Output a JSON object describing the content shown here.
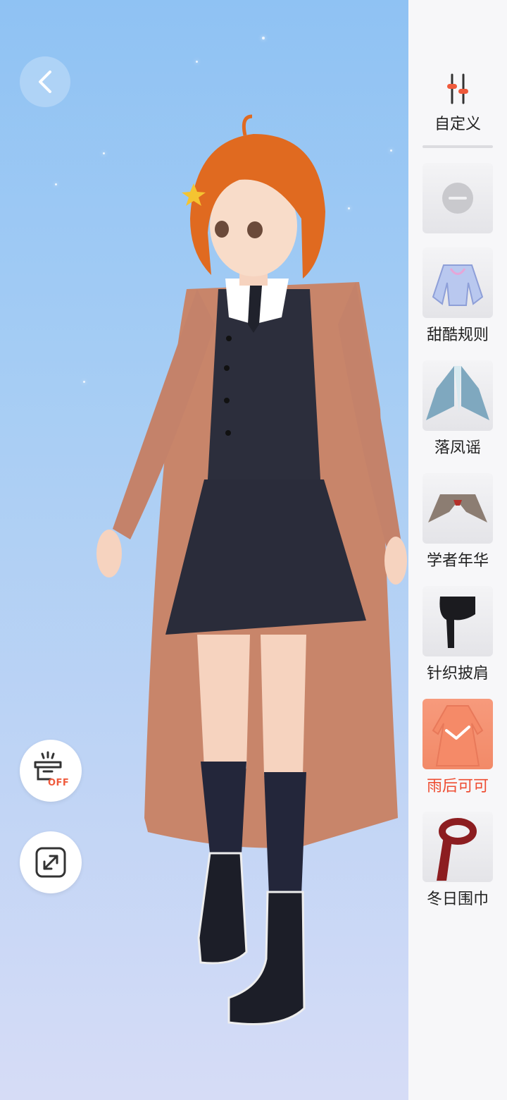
{
  "controls": {
    "back": "back",
    "display_toggle_state": "OFF",
    "expand": "expand"
  },
  "sidebar": {
    "custom_label": "自定义",
    "items": [
      {
        "label": "",
        "icon": "minus-icon"
      },
      {
        "label": "甜酷规则",
        "icon": "jacket-thumbnail"
      },
      {
        "label": "落凤谣",
        "icon": "cape-thumbnail"
      },
      {
        "label": "学者年华",
        "icon": "collar-thumbnail"
      },
      {
        "label": "针织披肩",
        "icon": "shawl-thumbnail"
      },
      {
        "label": "雨后可可",
        "icon": "coat-thumbnail",
        "selected": true
      },
      {
        "label": "冬日围巾",
        "icon": "scarf-thumbnail"
      }
    ]
  },
  "colors": {
    "accent": "#ee4d32",
    "selected_bg": "#f28a68"
  }
}
